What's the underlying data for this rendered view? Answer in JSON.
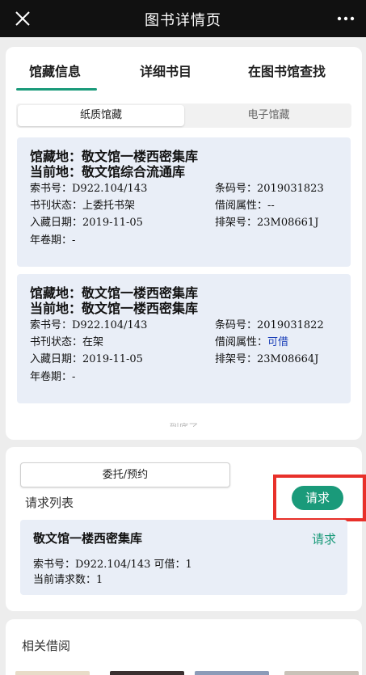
{
  "header": {
    "title": "图书详情页"
  },
  "tabs": [
    {
      "label": "馆藏信息"
    },
    {
      "label": "详细书目"
    },
    {
      "label": "在图书馆查找"
    }
  ],
  "subtabs": [
    {
      "label": "纸质馆藏"
    },
    {
      "label": "电子馆藏"
    }
  ],
  "holdings": [
    {
      "location": "馆藏地：敬文馆一楼西密集库",
      "current": "当前地：敬文馆综合流通库",
      "call_no": "索书号：D922.104/143",
      "barcode": "条码号：2019031823",
      "status": "书刊状态：上委托书架",
      "borrow_label": "借阅属性：",
      "borrow_value": "--",
      "date": "入藏日期：2019-11-05",
      "shelf": "排架号：23M08661J",
      "volume": "年卷期：-"
    },
    {
      "location": "馆藏地：敬文馆一楼西密集库",
      "current": "当前地：敬文馆一楼西密集库",
      "call_no": "索书号：D922.104/143",
      "barcode": "条码号：2019031822",
      "status": "书刊状态：在架",
      "borrow_label": "借阅属性：",
      "borrow_value": "可借",
      "date": "入藏日期：2019-11-05",
      "shelf": "排架号：23M08664J",
      "volume": "年卷期：-"
    }
  ],
  "hint": "到底了",
  "request_section": {
    "reserve_label": "委托/预约",
    "list_title": "请求列表",
    "request_button": "请求",
    "item": {
      "name": "敬文馆一楼西密集库",
      "link": "请求",
      "line1": "索书号：D922.104/143 可借：1",
      "line2": "当前请求数：1"
    }
  },
  "related": {
    "title": "相关借阅"
  },
  "colors": {
    "accent": "#1a9a7a",
    "highlight": "#e8302a",
    "card_bg": "#e9eef7"
  }
}
